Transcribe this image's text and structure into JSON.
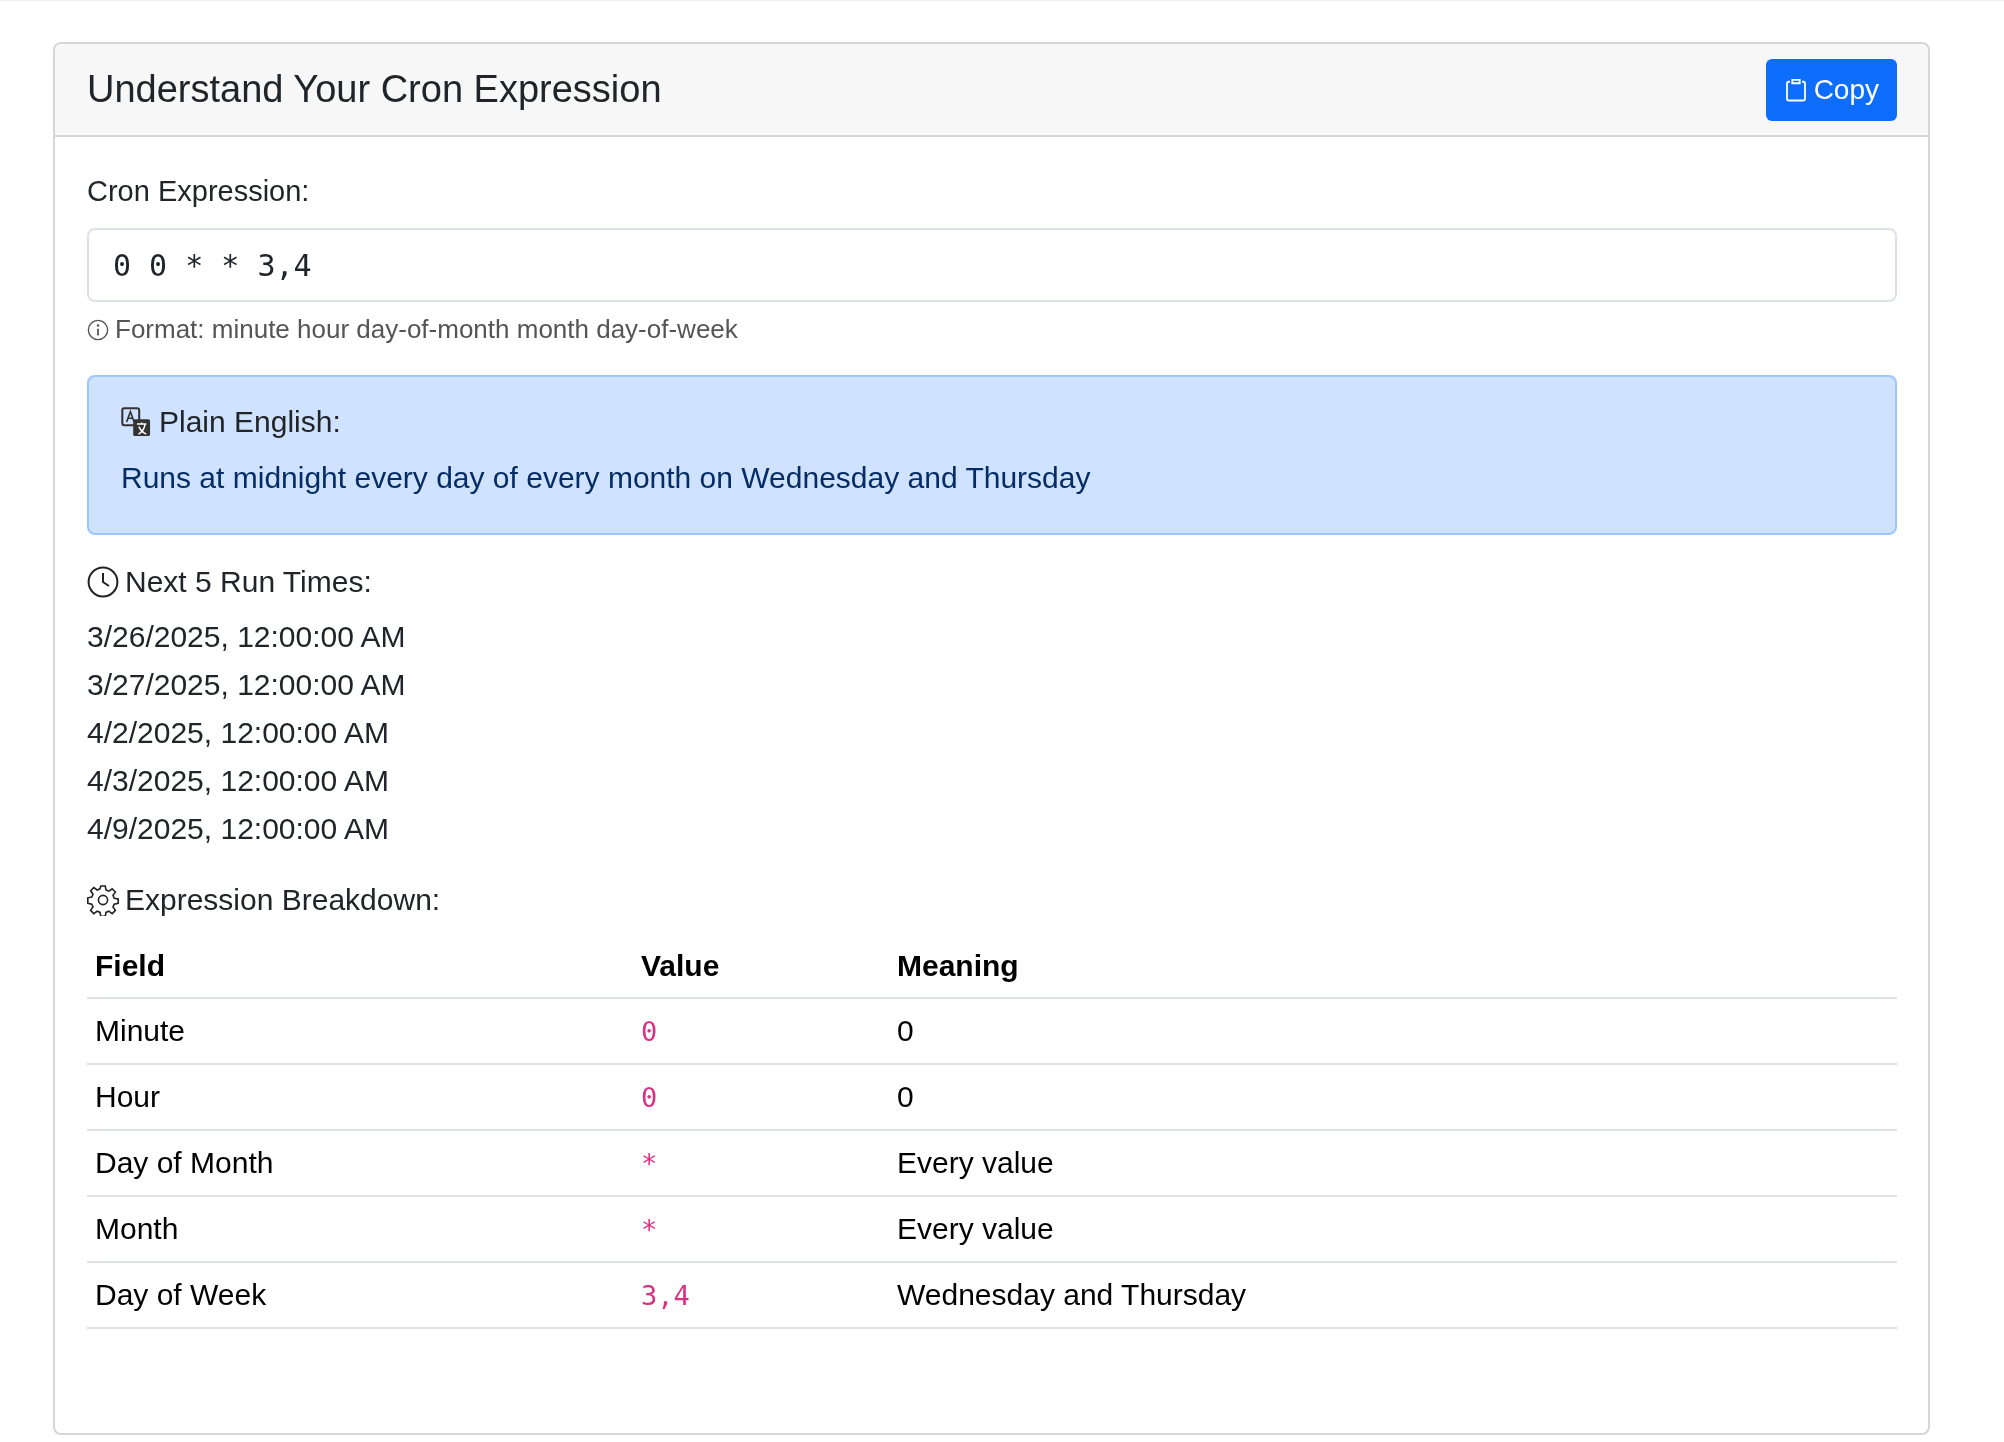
{
  "card": {
    "title": "Understand Your Cron Expression",
    "copy_button": "Copy"
  },
  "expression": {
    "label": "Cron Expression:",
    "value": "0 0 * * 3,4",
    "hint": "Format: minute hour day-of-month month day-of-week"
  },
  "plain_english": {
    "heading": "Plain English:",
    "text": "Runs at midnight every day of every month on Wednesday and Thursday"
  },
  "next_runs": {
    "heading": "Next 5 Run Times:",
    "times": [
      "3/26/2025, 12:00:00 AM",
      "3/27/2025, 12:00:00 AM",
      "4/2/2025, 12:00:00 AM",
      "4/3/2025, 12:00:00 AM",
      "4/9/2025, 12:00:00 AM"
    ]
  },
  "breakdown": {
    "heading": "Expression Breakdown:",
    "columns": [
      "Field",
      "Value",
      "Meaning"
    ],
    "rows": [
      {
        "field": "Minute",
        "value": "0",
        "meaning": "0"
      },
      {
        "field": "Hour",
        "value": "0",
        "meaning": "0"
      },
      {
        "field": "Day of Month",
        "value": "*",
        "meaning": "Every value"
      },
      {
        "field": "Month",
        "value": "*",
        "meaning": "Every value"
      },
      {
        "field": "Day of Week",
        "value": "3,4",
        "meaning": "Wednesday and Thursday"
      }
    ]
  }
}
